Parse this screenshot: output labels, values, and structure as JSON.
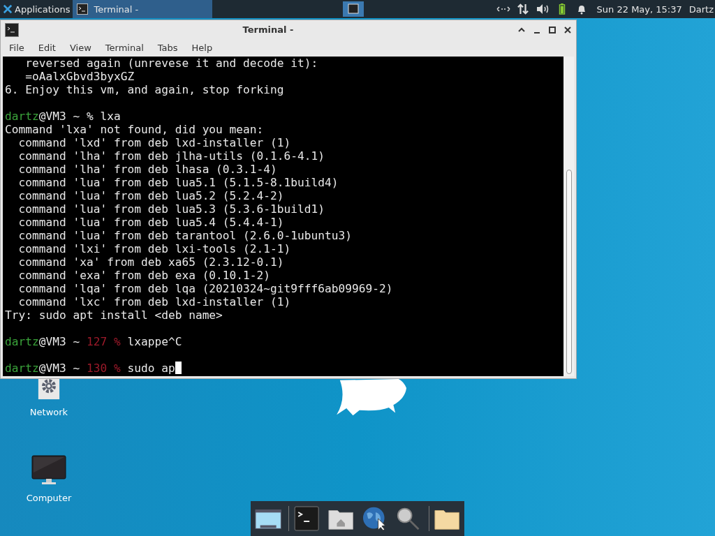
{
  "top_panel": {
    "applications_menu": "Applications",
    "tasks": [
      {
        "title": "Terminal -",
        "selected": true
      }
    ],
    "clock": "Sun 22 May, 15:37",
    "user": "Dartz"
  },
  "window": {
    "title": "Terminal -",
    "menu": [
      "File",
      "Edit",
      "View",
      "Terminal",
      "Tabs",
      "Help"
    ],
    "lines": [
      {
        "kind": "text",
        "text": "   reversed again (unrevese it and decode it):"
      },
      {
        "kind": "text",
        "text": "   =oAalxGbvd3byxGZ"
      },
      {
        "kind": "text",
        "text": "6. Enjoy this vm, and again, stop forking"
      },
      {
        "kind": "blank"
      },
      {
        "kind": "prompt",
        "user": "dartz",
        "host": "@VM3 ~",
        "sign": "%",
        "command": "lxa"
      },
      {
        "kind": "text",
        "text": "Command 'lxa' not found, did you mean:"
      },
      {
        "kind": "text",
        "text": "  command 'lxd' from deb lxd-installer (1)"
      },
      {
        "kind": "text",
        "text": "  command 'lha' from deb jlha-utils (0.1.6-4.1)"
      },
      {
        "kind": "text",
        "text": "  command 'lha' from deb lhasa (0.3.1-4)"
      },
      {
        "kind": "text",
        "text": "  command 'lua' from deb lua5.1 (5.1.5-8.1build4)"
      },
      {
        "kind": "text",
        "text": "  command 'lua' from deb lua5.2 (5.2.4-2)"
      },
      {
        "kind": "text",
        "text": "  command 'lua' from deb lua5.3 (5.3.6-1build1)"
      },
      {
        "kind": "text",
        "text": "  command 'lua' from deb lua5.4 (5.4.4-1)"
      },
      {
        "kind": "text",
        "text": "  command 'lua' from deb tarantool (2.6.0-1ubuntu3)"
      },
      {
        "kind": "text",
        "text": "  command 'lxi' from deb lxi-tools (2.1-1)"
      },
      {
        "kind": "text",
        "text": "  command 'xa' from deb xa65 (2.3.12-0.1)"
      },
      {
        "kind": "text",
        "text": "  command 'exa' from deb exa (0.10.1-2)"
      },
      {
        "kind": "text",
        "text": "  command 'lqa' from deb lqa (20210324~git9fff6ab09969-2)"
      },
      {
        "kind": "text",
        "text": "  command 'lxc' from deb lxd-installer (1)"
      },
      {
        "kind": "text",
        "text": "Try: sudo apt install <deb name>"
      },
      {
        "kind": "blank"
      },
      {
        "kind": "prompt",
        "user": "dartz",
        "host": "@VM3 ~",
        "status": "127",
        "sign": "%",
        "command": "lxappe^C"
      },
      {
        "kind": "blank"
      },
      {
        "kind": "prompt",
        "user": "dartz",
        "host": "@VM3 ~",
        "status": "130",
        "sign": "%",
        "command": "sudo ap",
        "cursor": true
      }
    ]
  },
  "desktop_icons": [
    {
      "kind": "network",
      "label": "Network"
    },
    {
      "kind": "computer",
      "label": "Computer"
    }
  ],
  "dock": [
    {
      "kind": "desktop"
    },
    {
      "kind": "terminal"
    },
    {
      "kind": "home"
    },
    {
      "kind": "browser"
    },
    {
      "kind": "search"
    },
    {
      "kind": "folder"
    }
  ]
}
